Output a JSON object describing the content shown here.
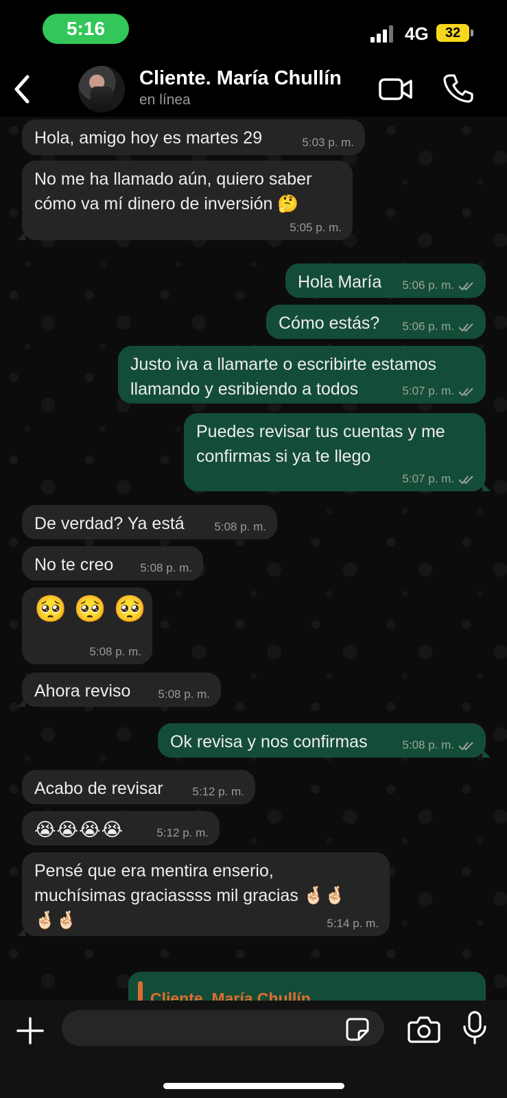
{
  "status_bar": {
    "time": "5:16",
    "network": "4G",
    "battery": "32"
  },
  "header": {
    "contact_name": "Cliente. María Chullín",
    "status": "en línea"
  },
  "messages": [
    {
      "text": "Hola, amigo hoy es martes 29",
      "time": "5:03 p. m."
    },
    {
      "text": "No me ha llamado aún, quiero saber\ncómo va mí dinero de inversión 🤔",
      "time": "5:05 p. m."
    },
    {
      "text": "Hola María",
      "time": "5:06 p. m."
    },
    {
      "text": "Cómo estás?",
      "time": "5:06 p. m."
    },
    {
      "text": "Justo iva a llamarte o escribirte estamos\nllamando y esribiendo a todos",
      "time": "5:07 p. m."
    },
    {
      "text": "Puedes revisar tus cuentas y me\nconfirmas si ya te llego",
      "time": "5:07 p. m."
    },
    {
      "text": "De verdad? Ya está",
      "time": "5:08 p. m."
    },
    {
      "text": "No te creo",
      "time": "5:08 p. m."
    },
    {
      "text": "🥺 🥺 🥺",
      "time": "5:08 p. m."
    },
    {
      "text": "Ahora reviso",
      "time": "5:08 p. m."
    },
    {
      "text": "Ok revisa y nos confirmas",
      "time": "5:08 p. m."
    },
    {
      "text": "Acabo de revisar",
      "time": "5:12 p. m."
    },
    {
      "text": "😭😭😭😭",
      "time": "5:12 p. m."
    },
    {
      "text": "Pensé que era mentira enserio,\nmuchísimas graciassss mil gracias 🤞🏻🤞🏻\n🤞🏻🤞🏻",
      "time": "5:14 p. m."
    }
  ],
  "reply_preview": {
    "name": "Cliente. María Chullín"
  },
  "input": {
    "placeholder": ""
  },
  "colors": {
    "outgoing_bubble": "#144d37",
    "incoming_bubble": "#252526",
    "status_time_pill": "#33c759",
    "reply_accent": "#e06c2f"
  }
}
